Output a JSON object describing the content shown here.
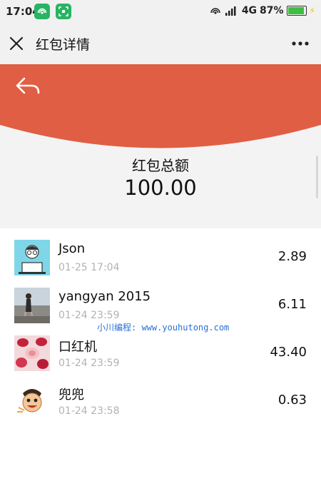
{
  "status_bar": {
    "time": "17:04",
    "network": "4G",
    "battery": "87%",
    "battery_level": 0.87
  },
  "nav": {
    "title": "红包详情",
    "close_icon": "close-icon",
    "more_icon": "more-icon"
  },
  "header": {
    "accent_color": "#e05e44",
    "back_icon": "back-arrow-icon"
  },
  "summary": {
    "label": "红包总额",
    "amount": "100.00"
  },
  "records": [
    {
      "name": "Json",
      "time": "01-25 17:04",
      "amount": "2.89"
    },
    {
      "name": "yangyan 2015",
      "time": "01-24 23:59",
      "amount": "6.11"
    },
    {
      "name": "口红机",
      "time": "01-24 23:59",
      "amount": "43.40"
    },
    {
      "name": "兜兜",
      "time": "01-24 23:58",
      "amount": "0.63"
    }
  ],
  "watermark": "小川编程: www.youhutong.com"
}
